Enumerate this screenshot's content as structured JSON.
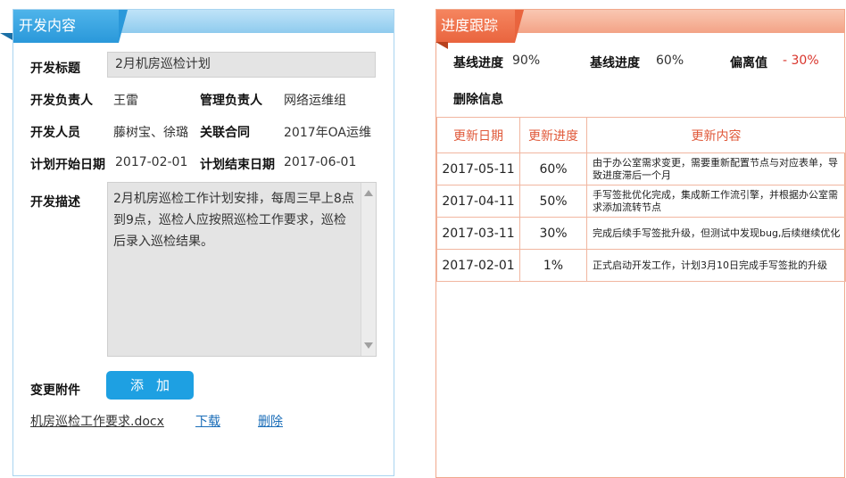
{
  "left_panel": {
    "tab_title": "开发内容",
    "fields": {
      "title_label": "开发标题",
      "title_value": "2月机房巡检计划",
      "owner_label": "开发负责人",
      "owner_value": "王雷",
      "manager_label": "管理负责人",
      "manager_value": "网络运维组",
      "staff_label": "开发人员",
      "staff_value": "藤树宝、徐璐",
      "contract_label": "关联合同",
      "contract_value": "2017年OA运维",
      "start_label": "计划开始日期",
      "start_value": "2017-02-01",
      "end_label": "计划结束日期",
      "end_value": "2017-06-01",
      "desc_label": "开发描述",
      "desc_value": "2月机房巡检工作计划安排，每周三早上8点到9点，巡检人应按照巡检工作要求，巡检后录入巡检结果。"
    },
    "attachment": {
      "label": "变更附件",
      "add_button": "添加",
      "file_name": "机房巡检工作要求.docx",
      "download": "下载",
      "delete": "删除"
    }
  },
  "right_panel": {
    "tab_title": "进度跟踪",
    "summary": {
      "baseline1_label": "基线进度",
      "baseline1_value": "90%",
      "baseline2_label": "基线进度",
      "baseline2_value": "60%",
      "deviation_label": "偏离值",
      "deviation_value": "- 30%",
      "delete_info": "删除信息"
    },
    "table": {
      "headers": [
        "更新日期",
        "更新进度",
        "更新内容"
      ],
      "rows": [
        {
          "date": "2017-05-11",
          "progress": "60%",
          "content": "由于办公室需求变更，需要重新配置节点与对应表单，导致进度滞后一个月"
        },
        {
          "date": "2017-04-11",
          "progress": "50%",
          "content": "手写签批优化完成，集成新工作流引擎，并根据办公室需求添加流转节点"
        },
        {
          "date": "2017-03-11",
          "progress": "30%",
          "content": "完成后续手写签批升级，但测试中发现bug,后续继续优化"
        },
        {
          "date": "2017-02-01",
          "progress": "1%",
          "content": "正式启动开发工作，计划3月10日完成手写签批的升级"
        }
      ]
    },
    "colors": {
      "accent": "#e9643e",
      "deviation": "#d9342b"
    }
  },
  "colors": {
    "left_accent": "#2a98da",
    "add_button": "#1ea0e2",
    "link": "#1a6db8"
  }
}
